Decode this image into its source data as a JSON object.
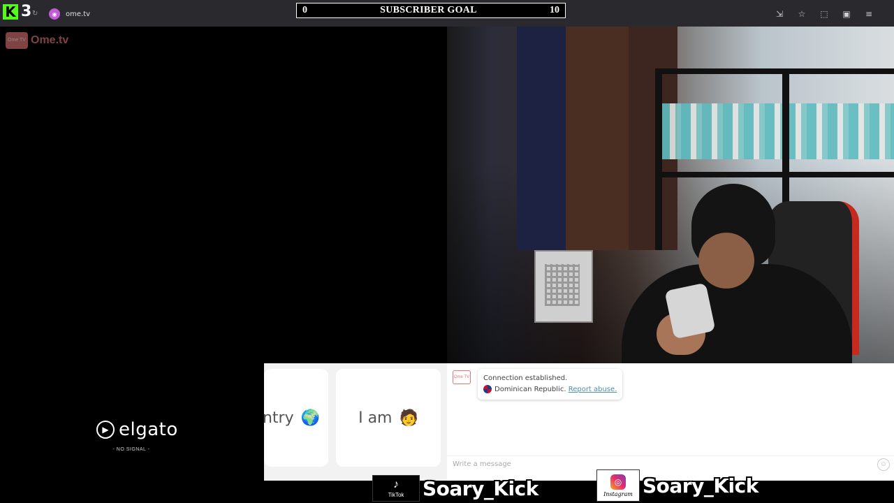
{
  "kick": {
    "logo": "K",
    "count": "3"
  },
  "browser": {
    "url": "ome.tv"
  },
  "subscriber_goal": {
    "current": "0",
    "title": "SUBSCRIBER GOAL",
    "target": "10"
  },
  "ome_logo": {
    "tv_text": "Ome TV",
    "text": "Ome.tv"
  },
  "options": {
    "country_label": "ntry",
    "country_emoji": "🌍",
    "iam_label": "I am",
    "iam_emoji": "🧑"
  },
  "chat": {
    "logo_text": "Ome TV",
    "connection": "Connection established.",
    "country": "Dominican Republic.",
    "report": "Report abuse.",
    "placeholder": "Write a message",
    "emoji_button": "☺"
  },
  "elgato": {
    "name": "elgato",
    "status": "- NO SIGNAL -"
  },
  "socials": {
    "tiktok": {
      "label": "TikTok",
      "handle": "Soary_Kick"
    },
    "instagram": {
      "label": "Instagram",
      "handle": "Soary_Kick"
    }
  }
}
